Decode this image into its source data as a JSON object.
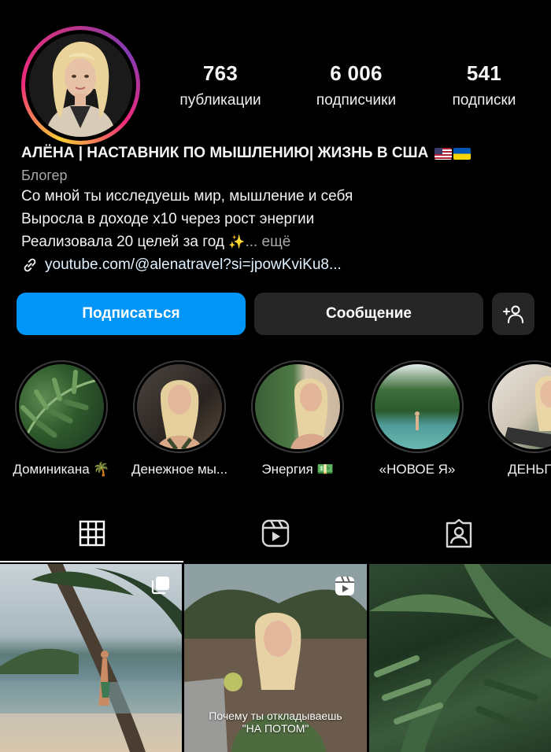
{
  "profile": {
    "stats": [
      {
        "value": "763",
        "label": "публикации"
      },
      {
        "value": "6 006",
        "label": "подписчики"
      },
      {
        "value": "541",
        "label": "подписки"
      }
    ],
    "name": "АЛЁНА | НАСТАВНИК ПО МЫШЛЕНИЮ| ЖИЗНЬ В США",
    "category": "Блогер",
    "bio_lines": [
      "Со мной ты исследуешь мир, мышление и себя",
      "Выросла в доходе х10 через рост энергии",
      "Реализовала 20 целей за год"
    ],
    "more_label": "... ещё",
    "link": "youtube.com/@alenatravel?si=jpowKviKu8..."
  },
  "actions": {
    "follow_label": "Подписаться",
    "message_label": "Сообщение"
  },
  "highlights": [
    {
      "label": "Доминикана 🌴"
    },
    {
      "label": "Денежное мы..."
    },
    {
      "label": "Энергия 💵"
    },
    {
      "label": "«НОВОЕ Я»"
    },
    {
      "label": "ДЕНЬГИ"
    }
  ],
  "tabs": [
    {
      "icon": "grid-icon"
    },
    {
      "icon": "reels-icon"
    },
    {
      "icon": "tagged-icon"
    }
  ],
  "posts": [
    {
      "type": "carousel"
    },
    {
      "type": "reel",
      "caption_lines": [
        "Почему ты откладываешь",
        "\"НА ПОТОМ\""
      ]
    },
    {
      "type": "photo"
    }
  ],
  "colors": {
    "background": "#000000",
    "follow_button": "#0095f6",
    "secondary_button": "#262626",
    "muted_text": "#a8a8a8"
  }
}
